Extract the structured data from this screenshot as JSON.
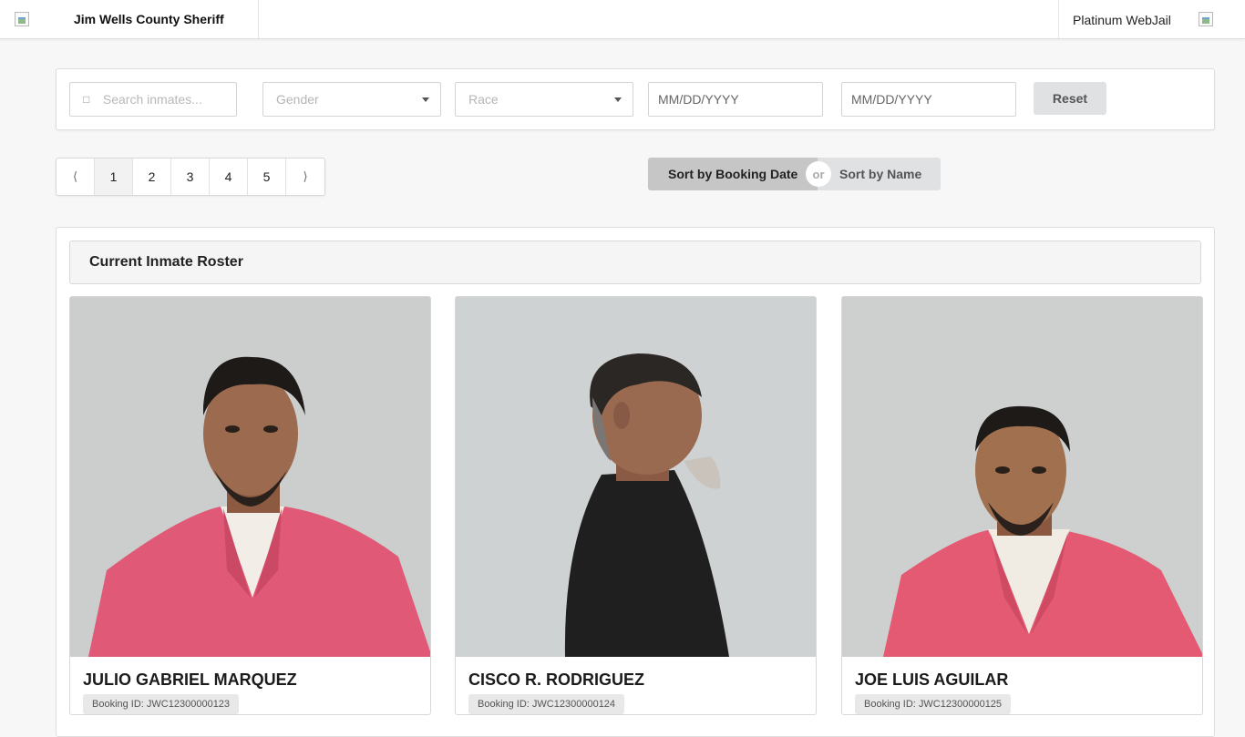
{
  "header": {
    "brand": "Jim Wells County Sheriff",
    "product": "Platinum WebJail"
  },
  "filters": {
    "search_placeholder": "Search inmates...",
    "gender_placeholder": "Gender",
    "race_placeholder": "Race",
    "date_from_placeholder": "MM/DD/YYYY",
    "date_to_placeholder": "MM/DD/YYYY",
    "reset_label": "Reset"
  },
  "pagination": {
    "prev": "⟨",
    "pages": [
      "1",
      "2",
      "3",
      "4",
      "5"
    ],
    "current": "1",
    "next": "⟩"
  },
  "sort": {
    "by_date": "Sort by Booking Date",
    "or": "or",
    "by_name": "Sort by Name"
  },
  "roster": {
    "title": "Current Inmate Roster",
    "inmates": [
      {
        "name": "JULIO GABRIEL MARQUEZ",
        "booking": "Booking ID: JWC12300000123",
        "shirt_color": "#e05a78",
        "pose": "front"
      },
      {
        "name": "CISCO R. RODRIGUEZ",
        "booking": "Booking ID: JWC12300000124",
        "shirt_color": "#1f1f1f",
        "pose": "profile"
      },
      {
        "name": "JOE LUIS AGUILAR",
        "booking": "Booking ID: JWC12300000125",
        "shirt_color": "#e35a72",
        "pose": "front"
      }
    ]
  },
  "colors": {
    "wall": "#c9cccc",
    "skin": "#9c6a4f",
    "hair": "#1d1a18"
  }
}
